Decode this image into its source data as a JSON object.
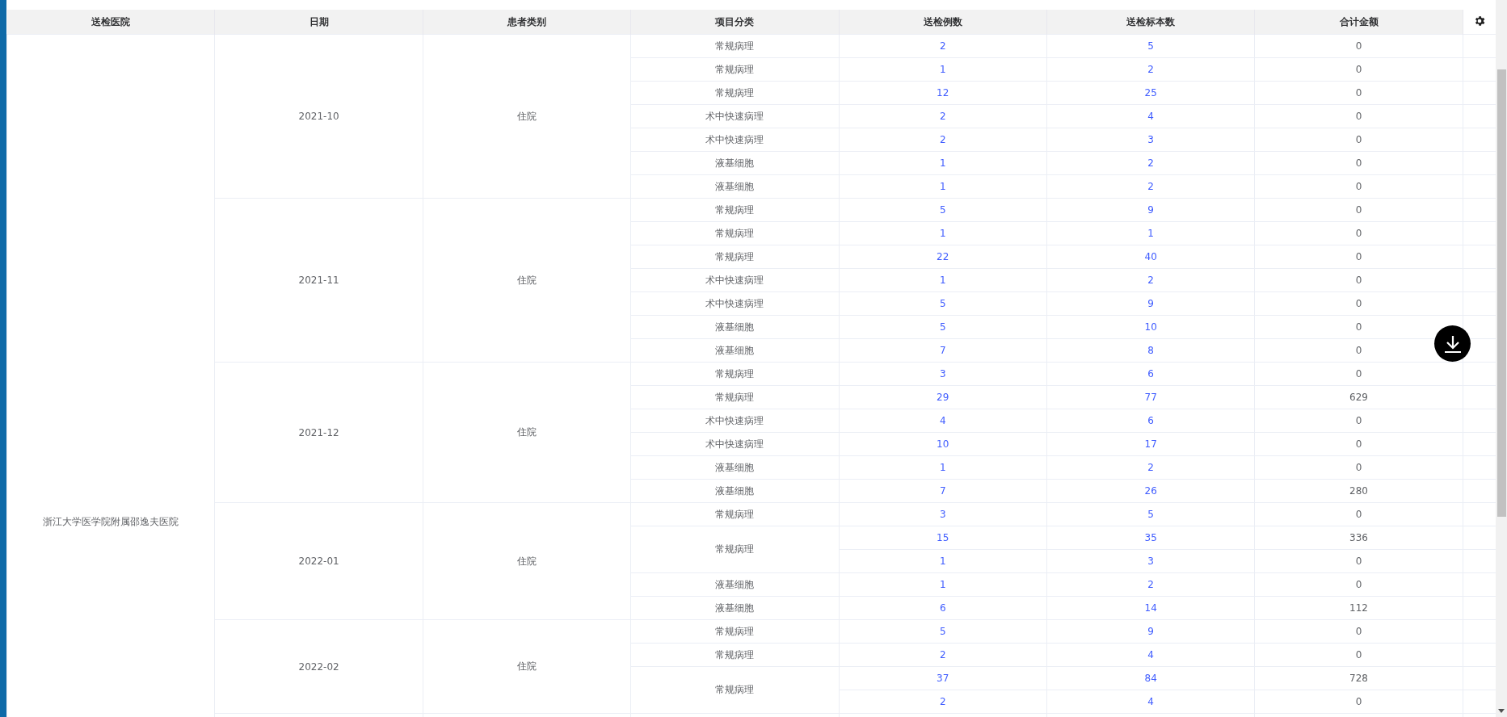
{
  "table": {
    "columns": [
      "送检医院",
      "日期",
      "患者类别",
      "项目分类",
      "送检例数",
      "送检标本数",
      "合计金额"
    ],
    "hospital": "浙江大学医学院附属邵逸夫医院",
    "groups": [
      {
        "date": "2021-10",
        "patient_type": "住院",
        "items": [
          {
            "category": "常规病理",
            "rows": [
              {
                "cases": "2",
                "specimens": "5",
                "amount": "0"
              }
            ]
          },
          {
            "category": "常规病理",
            "rows": [
              {
                "cases": "1",
                "specimens": "2",
                "amount": "0"
              }
            ]
          },
          {
            "category": "常规病理",
            "rows": [
              {
                "cases": "12",
                "specimens": "25",
                "amount": "0"
              }
            ]
          },
          {
            "category": "术中快速病理",
            "rows": [
              {
                "cases": "2",
                "specimens": "4",
                "amount": "0"
              }
            ]
          },
          {
            "category": "术中快速病理",
            "rows": [
              {
                "cases": "2",
                "specimens": "3",
                "amount": "0"
              }
            ]
          },
          {
            "category": "液基细胞",
            "rows": [
              {
                "cases": "1",
                "specimens": "2",
                "amount": "0"
              }
            ]
          },
          {
            "category": "液基细胞",
            "rows": [
              {
                "cases": "1",
                "specimens": "2",
                "amount": "0"
              }
            ]
          }
        ]
      },
      {
        "date": "2021-11",
        "patient_type": "住院",
        "items": [
          {
            "category": "常规病理",
            "rows": [
              {
                "cases": "5",
                "specimens": "9",
                "amount": "0"
              }
            ]
          },
          {
            "category": "常规病理",
            "rows": [
              {
                "cases": "1",
                "specimens": "1",
                "amount": "0"
              }
            ]
          },
          {
            "category": "常规病理",
            "rows": [
              {
                "cases": "22",
                "specimens": "40",
                "amount": "0"
              }
            ]
          },
          {
            "category": "术中快速病理",
            "rows": [
              {
                "cases": "1",
                "specimens": "2",
                "amount": "0"
              }
            ]
          },
          {
            "category": "术中快速病理",
            "rows": [
              {
                "cases": "5",
                "specimens": "9",
                "amount": "0"
              }
            ]
          },
          {
            "category": "液基细胞",
            "rows": [
              {
                "cases": "5",
                "specimens": "10",
                "amount": "0"
              }
            ]
          },
          {
            "category": "液基细胞",
            "rows": [
              {
                "cases": "7",
                "specimens": "8",
                "amount": "0"
              }
            ]
          }
        ]
      },
      {
        "date": "2021-12",
        "patient_type": "住院",
        "items": [
          {
            "category": "常规病理",
            "rows": [
              {
                "cases": "3",
                "specimens": "6",
                "amount": "0"
              }
            ]
          },
          {
            "category": "常规病理",
            "rows": [
              {
                "cases": "29",
                "specimens": "77",
                "amount": "629"
              }
            ]
          },
          {
            "category": "术中快速病理",
            "rows": [
              {
                "cases": "4",
                "specimens": "6",
                "amount": "0"
              }
            ]
          },
          {
            "category": "术中快速病理",
            "rows": [
              {
                "cases": "10",
                "specimens": "17",
                "amount": "0"
              }
            ]
          },
          {
            "category": "液基细胞",
            "rows": [
              {
                "cases": "1",
                "specimens": "2",
                "amount": "0"
              }
            ]
          },
          {
            "category": "液基细胞",
            "rows": [
              {
                "cases": "7",
                "specimens": "26",
                "amount": "280"
              }
            ]
          }
        ]
      },
      {
        "date": "2022-01",
        "patient_type": "住院",
        "items": [
          {
            "category": "常规病理",
            "rows": [
              {
                "cases": "3",
                "specimens": "5",
                "amount": "0"
              }
            ]
          },
          {
            "category": "常规病理",
            "rows": [
              {
                "cases": "15",
                "specimens": "35",
                "amount": "336"
              },
              {
                "cases": "1",
                "specimens": "3",
                "amount": "0"
              }
            ]
          },
          {
            "category": "液基细胞",
            "rows": [
              {
                "cases": "1",
                "specimens": "2",
                "amount": "0"
              }
            ]
          },
          {
            "category": "液基细胞",
            "rows": [
              {
                "cases": "6",
                "specimens": "14",
                "amount": "112"
              }
            ]
          }
        ]
      },
      {
        "date": "2022-02",
        "patient_type": "住院",
        "items": [
          {
            "category": "常规病理",
            "rows": [
              {
                "cases": "5",
                "specimens": "9",
                "amount": "0"
              }
            ]
          },
          {
            "category": "常规病理",
            "rows": [
              {
                "cases": "2",
                "specimens": "4",
                "amount": "0"
              }
            ]
          },
          {
            "category": "常规病理",
            "rows": [
              {
                "cases": "37",
                "specimens": "84",
                "amount": "728"
              },
              {
                "cases": "2",
                "specimens": "4",
                "amount": "0"
              }
            ]
          }
        ]
      }
    ]
  }
}
